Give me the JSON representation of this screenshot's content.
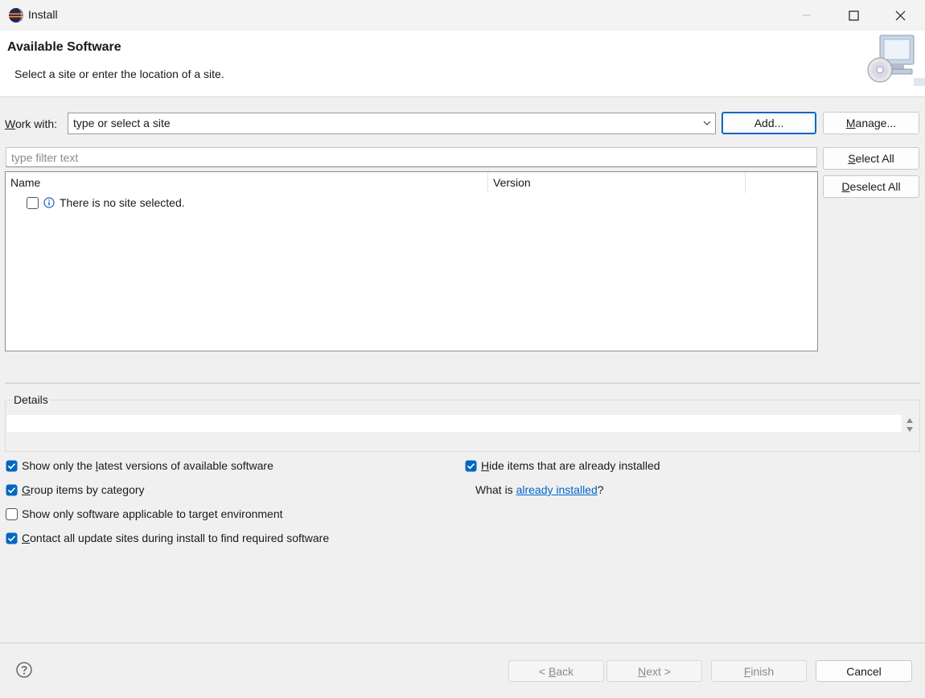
{
  "window": {
    "title": "Install"
  },
  "banner": {
    "title": "Available Software",
    "subtitle": "Select a site or enter the location of a site."
  },
  "work_with": {
    "label_mnemonic": "W",
    "label_rest": "ork with:",
    "value": "type or select a site"
  },
  "buttons": {
    "add": "Add...",
    "manage_mnemonic": "M",
    "manage_rest": "anage...",
    "select_all_mnemonic": "S",
    "select_all_rest": "elect All",
    "deselect_all_mnemonic": "D",
    "deselect_all_rest": "eselect All"
  },
  "filter": {
    "placeholder": "type filter text"
  },
  "table": {
    "columns": [
      "Name",
      "Version"
    ],
    "rows": [
      {
        "name": "There is no site selected.",
        "checked": false
      }
    ]
  },
  "details": {
    "label": "Details"
  },
  "options": {
    "latest_pre": "Show only the ",
    "latest_mnemonic": "l",
    "latest_post": "atest versions of available software",
    "latest_checked": true,
    "group_mnemonic": "G",
    "group_rest": "roup items by category",
    "group_checked": true,
    "applicable": "Show only software applicable to target environment",
    "applicable_checked": false,
    "contact_mnemonic": "C",
    "contact_rest": "ontact all update sites during install to find required software",
    "contact_checked": true,
    "hide_mnemonic": "H",
    "hide_rest": "ide items that are already installed",
    "hide_checked": true,
    "what_is_pre": "What is ",
    "what_is_link": "already installed",
    "what_is_post": "?"
  },
  "footer": {
    "back_pre": "< ",
    "back_mnemonic": "B",
    "back_rest": "ack",
    "next_mnemonic": "N",
    "next_rest": "ext >",
    "finish_mnemonic": "F",
    "finish_rest": "inish",
    "cancel": "Cancel"
  },
  "colors": {
    "accent": "#0067c0",
    "link": "#0066cc"
  }
}
